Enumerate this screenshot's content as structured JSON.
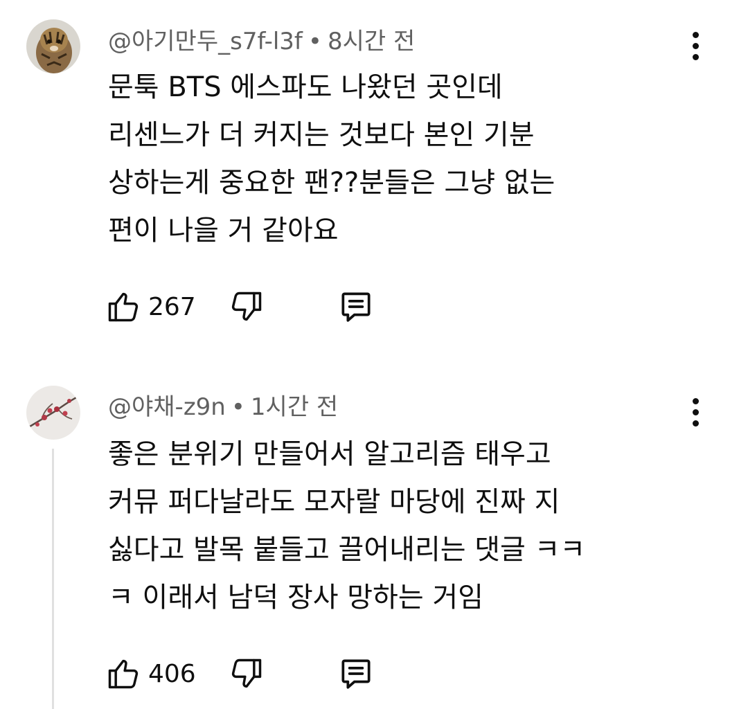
{
  "comments": [
    {
      "author": "@아기만두_s7f-l3f",
      "separator": "•",
      "time": "8시간 전",
      "lines": [
        "문툭 BTS 에스파도 나왔던 곳인데",
        "리센느가 더 커지는 것보다 본인 기분",
        "상하는게 중요한 팬??분들은 그냥 없는",
        "편이 나을 거 같아요"
      ],
      "likes": "267",
      "avatar_icon": "tiger-cub-avatar"
    },
    {
      "author": "@야채-z9n",
      "separator": "•",
      "time": "1시간 전",
      "lines": [
        "좋은 분위기 만들어서 알고리즘 태우고",
        "커뮤 퍼다날라도 모자랄 마당에 진짜 지",
        "싫다고 발목 붙들고 끌어내리는 댓글 ㅋㅋ",
        "ㅋ 이래서 남덕 장사 망하는 거임"
      ],
      "likes": "406",
      "avatar_icon": "plum-blossom-avatar"
    }
  ],
  "icons": {
    "like": "thumbs-up-icon",
    "dislike": "thumbs-down-icon",
    "reply": "reply-icon",
    "more": "more-vertical-icon"
  },
  "colors": {
    "text": "#0f0f0f",
    "meta": "#606060",
    "thread_line": "#e0e0e0"
  }
}
